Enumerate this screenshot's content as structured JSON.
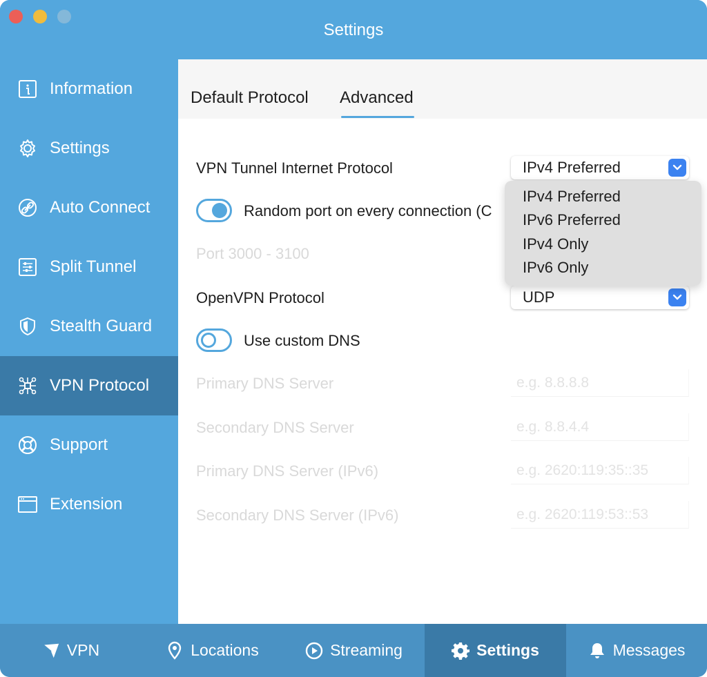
{
  "window": {
    "title": "Settings"
  },
  "sidebar": {
    "items": [
      {
        "label": "Information",
        "icon": "info-icon"
      },
      {
        "label": "Settings",
        "icon": "gear-icon"
      },
      {
        "label": "Auto Connect",
        "icon": "link-icon"
      },
      {
        "label": "Split Tunnel",
        "icon": "sliders-icon"
      },
      {
        "label": "Stealth Guard",
        "icon": "shield-icon"
      },
      {
        "label": "VPN Protocol",
        "icon": "network-icon",
        "active": true
      },
      {
        "label": "Support",
        "icon": "lifebuoy-icon"
      },
      {
        "label": "Extension",
        "icon": "browser-window-icon"
      }
    ]
  },
  "tabs": [
    {
      "label": "Default Protocol"
    },
    {
      "label": "Advanced",
      "active": true
    }
  ],
  "settings": {
    "tunnel_protocol": {
      "label": "VPN Tunnel Internet Protocol",
      "value": "IPv4 Preferred"
    },
    "random_port": {
      "label": "Random port on every connection (C",
      "enabled": true
    },
    "port_range": {
      "label": "Port 3000 - 3100"
    },
    "openvpn_protocol": {
      "label": "OpenVPN Protocol",
      "value": "UDP"
    },
    "custom_dns": {
      "label": "Use custom DNS",
      "enabled": false
    },
    "dns": [
      {
        "label": "Primary DNS Server",
        "placeholder": "e.g. 8.8.8.8"
      },
      {
        "label": "Secondary DNS Server",
        "placeholder": "e.g. 8.8.4.4"
      },
      {
        "label": "Primary DNS Server (IPv6)",
        "placeholder": "e.g. 2620:119:35::35"
      },
      {
        "label": "Secondary DNS Server (IPv6)",
        "placeholder": "e.g. 2620:119:53::53"
      }
    ]
  },
  "dropdown": {
    "options": [
      "IPv4 Preferred",
      "IPv6 Preferred",
      "IPv4 Only",
      "IPv6 Only"
    ]
  },
  "bottom_nav": [
    {
      "label": "VPN",
      "icon": "vpn-logo-icon"
    },
    {
      "label": "Locations",
      "icon": "location-pin-icon"
    },
    {
      "label": "Streaming",
      "icon": "play-circle-icon"
    },
    {
      "label": "Settings",
      "icon": "gear-icon",
      "active": true
    },
    {
      "label": "Messages",
      "icon": "bell-icon"
    }
  ],
  "colors": {
    "brand": "#54a7dd",
    "active_nav": "#3a7aa7",
    "select_chevron": "#3b82f0",
    "dropdown_bg": "#dfdfdf"
  }
}
